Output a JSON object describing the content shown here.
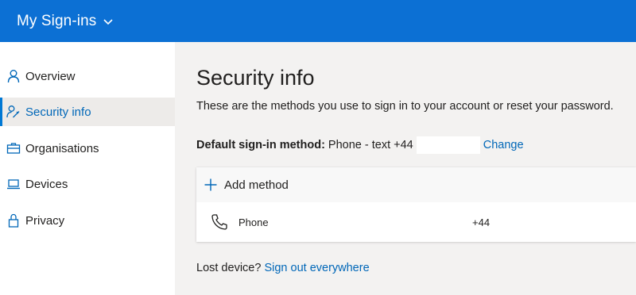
{
  "header": {
    "app_title": "My Sign-ins",
    "brand_color": "#0c70d4"
  },
  "sidebar": {
    "items": [
      {
        "label": "Overview",
        "icon": "person-icon"
      },
      {
        "label": "Security info",
        "icon": "person-key-icon",
        "active": true
      },
      {
        "label": "Organisations",
        "icon": "briefcase-icon"
      },
      {
        "label": "Devices",
        "icon": "laptop-icon"
      },
      {
        "label": "Privacy",
        "icon": "lock-icon"
      }
    ]
  },
  "main": {
    "title": "Security info",
    "description": "These are the methods you use to sign in to your account or reset your password.",
    "default_method": {
      "label": "Default sign-in method:",
      "value": "Phone - text +44",
      "change_link": "Change"
    },
    "methods_card": {
      "add_label": "Add method",
      "rows": [
        {
          "name": "Phone",
          "value": "+44",
          "icon": "phone-icon"
        }
      ]
    },
    "lost_device": {
      "text": "Lost device?",
      "link": "Sign out everywhere"
    }
  },
  "colors": {
    "link": "#0067b8",
    "active_bar": "#0078d4"
  }
}
